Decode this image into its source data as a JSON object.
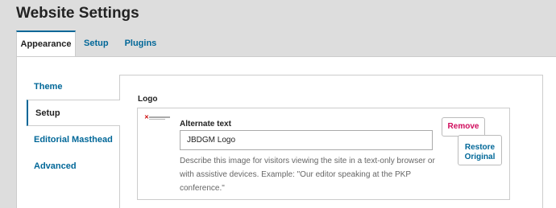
{
  "page": {
    "title": "Website Settings"
  },
  "tabs": [
    {
      "label": "Appearance",
      "active": true
    },
    {
      "label": "Setup",
      "active": false
    },
    {
      "label": "Plugins",
      "active": false
    }
  ],
  "sidenav": [
    {
      "label": "Theme",
      "active": false
    },
    {
      "label": "Setup",
      "active": true
    },
    {
      "label": "Editorial Masthead",
      "active": false
    },
    {
      "label": "Advanced",
      "active": false
    }
  ],
  "logo": {
    "label": "Logo",
    "alt_text_label": "Alternate text",
    "alt_text_value": "JBDGM Logo",
    "description": "Describe this image for visitors viewing the site in a text-only browser or with assistive devices. Example: \"Our editor speaking at the PKP conference.\"",
    "remove_label": "Remove",
    "restore_label": "Restore Original"
  },
  "colors": {
    "accent": "#006798",
    "danger": "#d00c5c"
  }
}
